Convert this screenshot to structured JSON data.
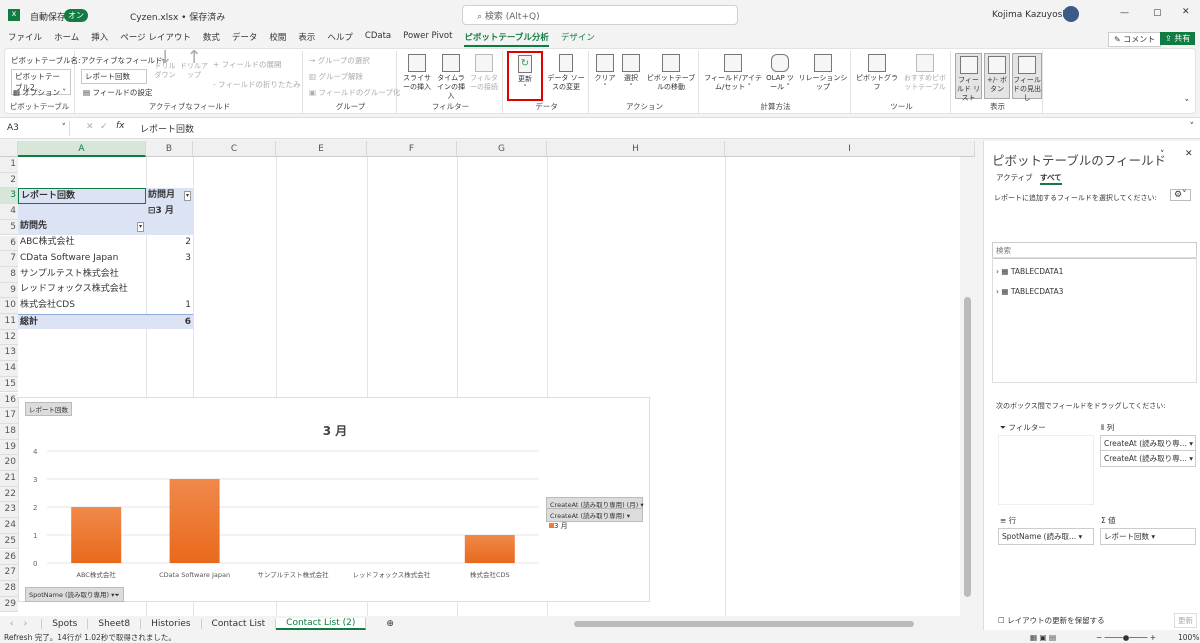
{
  "titlebar": {
    "autosave": "自動保存",
    "toggle": "オン",
    "filename": "Cyzen.xlsx • 保存済み",
    "search": "検索 (Alt+Q)",
    "user": "Kojima Kazuyoshi",
    "comment": "コメント",
    "share": "共有"
  },
  "menu": [
    "ファイル",
    "ホーム",
    "挿入",
    "ページ レイアウト",
    "数式",
    "データ",
    "校閲",
    "表示",
    "ヘルプ",
    "CData",
    "Power Pivot",
    "ピボットテーブル分析",
    "デザイン"
  ],
  "ribbon": {
    "pivot": {
      "name_label": "ピボットテーブル名:",
      "name_value": "ピボットテーブル2",
      "options": "オプション",
      "group": "ピボットテーブル"
    },
    "active_field": {
      "label": "アクティブなフィールド:",
      "value": "レポート回数",
      "settings": "フィールドの設定",
      "drill_down": "ドリル ダウン",
      "drill_up": "ドリルアップ",
      "expand": "フィールドの展開",
      "collapse": "フィールドの折りたたみ",
      "group": "アクティブなフィールド"
    },
    "grouping": {
      "select": "グループの選択",
      "ungroup": "グループ解除",
      "field_group": "フィールドのグループ化",
      "group": "グループ"
    },
    "filter": {
      "slicer": "スライサーの挿入",
      "timeline": "タイムラインの挿入",
      "connections": "フィルターの接続",
      "group": "フィルター"
    },
    "data": {
      "refresh": "更新",
      "change_source": "データ ソースの変更",
      "group": "データ"
    },
    "actions": {
      "clear": "クリア",
      "select": "選択",
      "move": "ピボットテーブルの移動",
      "group": "アクション"
    },
    "calc": {
      "fields": "フィールド/アイテム/セット",
      "olap": "OLAP ツール",
      "relations": "リレーションシップ",
      "group": "計算方法"
    },
    "tools": {
      "pivotchart": "ピボットグラフ",
      "recommended": "おすすめピボットテーブル",
      "group": "ツール"
    },
    "show": {
      "field_list": "フィールド リスト",
      "buttons": "+/- ボタン",
      "headers": "フィールドの見出し",
      "group": "表示"
    }
  },
  "formula": {
    "namebox": "A3",
    "fx": "fx",
    "value": "レポート回数"
  },
  "columns": [
    "A",
    "B",
    "C",
    "E",
    "F",
    "G",
    "H",
    "I"
  ],
  "rows": [
    "1",
    "2",
    "3",
    "4",
    "5",
    "6",
    "7",
    "8",
    "9",
    "10",
    "11",
    "12",
    "13",
    "14",
    "15",
    "16",
    "17",
    "18",
    "19",
    "20",
    "21",
    "22",
    "23",
    "24",
    "25",
    "26",
    "27",
    "28",
    "29"
  ],
  "pivot": {
    "a3": "レポート回数",
    "b3": "訪問月",
    "b4": "⊟3 月",
    "a5": "訪問先",
    "items": [
      {
        "name": "ABC株式会社",
        "value": "2"
      },
      {
        "name": "CData Software Japan",
        "value": "3"
      },
      {
        "name": "サンプルテスト株式会社",
        "value": ""
      },
      {
        "name": "レッドフォックス株式会社",
        "value": ""
      },
      {
        "name": "株式会社CDS",
        "value": "1"
      }
    ],
    "total_label": "総計",
    "total_value": "6"
  },
  "chart_data": {
    "type": "bar",
    "title": "3 月",
    "value_button": "レポート回数",
    "axis_button": "SpotName (読み取り専用)",
    "legend_buttons": [
      "CreateAt (読み取り専用) (月)",
      "CreateAt (読み取り専用)"
    ],
    "legend": "3 月",
    "legend_placement": "right",
    "categories": [
      "ABC株式会社",
      "CData Software Japan",
      "サンプルテスト株式会社",
      "レッドフォックス株式会社",
      "株式会社CDS"
    ],
    "values": [
      2,
      3,
      0,
      0,
      1
    ],
    "ylim": [
      0,
      4
    ],
    "yticks": [
      "0",
      "1",
      "2",
      "3",
      "4"
    ],
    "color": "#ed7d31"
  },
  "panel": {
    "title": "ピボットテーブルのフィールド",
    "tab_active": "アクティブ",
    "tab_all": "すべて",
    "choose": "レポートに追加するフィールドを選択してください:",
    "search": "検索",
    "tables": [
      "TABLECDATA1",
      "TABLECDATA3"
    ],
    "drag": "次のボックス間でフィールドをドラッグしてください:",
    "filters": "フィルター",
    "columns": "列",
    "rows": "行",
    "values": "値",
    "col_items": [
      "CreateAt (読み取り専...",
      "CreateAt (読み取り専..."
    ],
    "row_items": [
      "SpotName (読み取..."
    ],
    "value_items": [
      "レポート回数"
    ],
    "defer": "レイアウトの更新を保留する",
    "update": "更新"
  },
  "sheets": [
    "Spots",
    "Sheet8",
    "Histories",
    "Contact List",
    "Contact List (2)"
  ],
  "status": {
    "text": "Refresh 完了。14行が 1.02秒で取得されました。",
    "zoom": "100%"
  }
}
